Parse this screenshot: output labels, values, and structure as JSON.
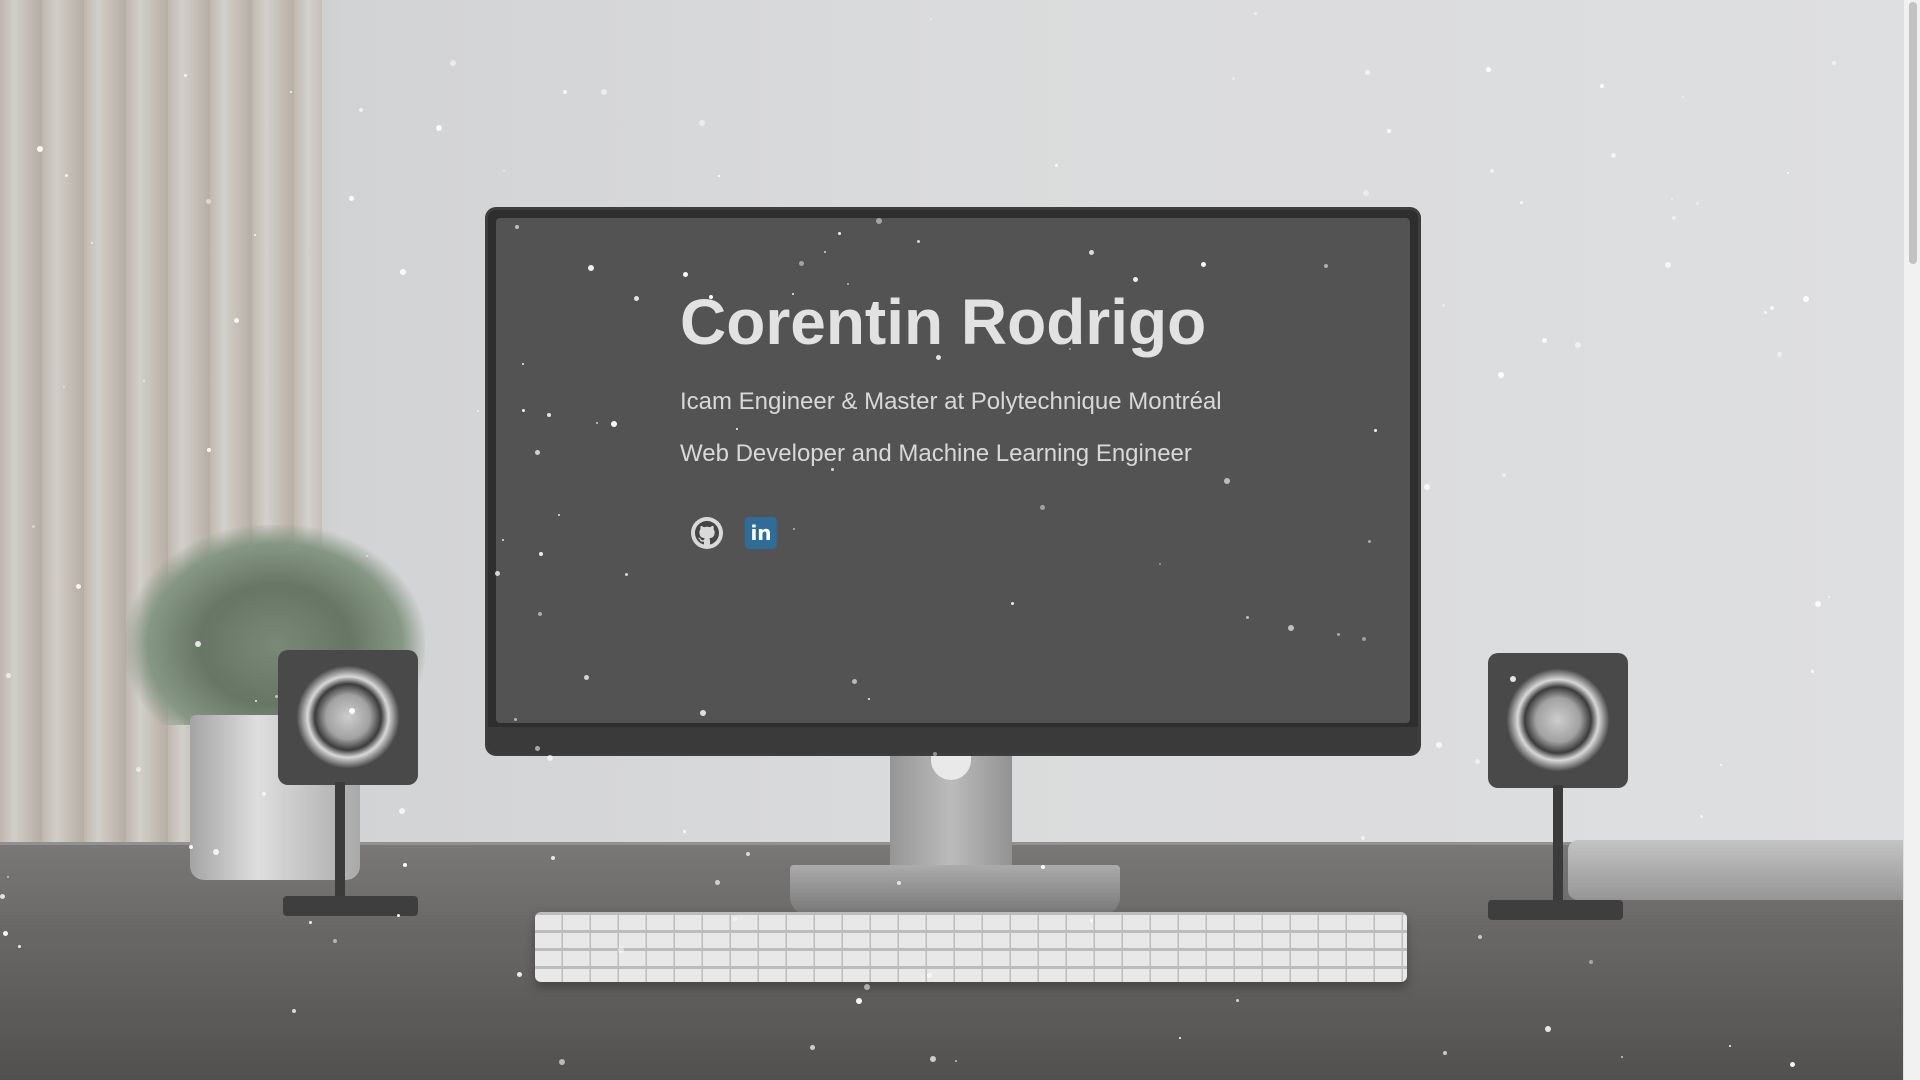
{
  "hero": {
    "name": "Corentin Rodrigo",
    "tagline_1": "Icam Engineer & Master at Polytechnique Montréal",
    "tagline_2": "Web Developer and Machine Learning Engineer"
  },
  "socials": [
    {
      "name": "GitHub",
      "icon": "github-icon"
    },
    {
      "name": "LinkedIn",
      "icon": "linkedin-icon",
      "label": "in",
      "color": "#2f6c98"
    }
  ],
  "scrollbar": {
    "position": "top"
  }
}
